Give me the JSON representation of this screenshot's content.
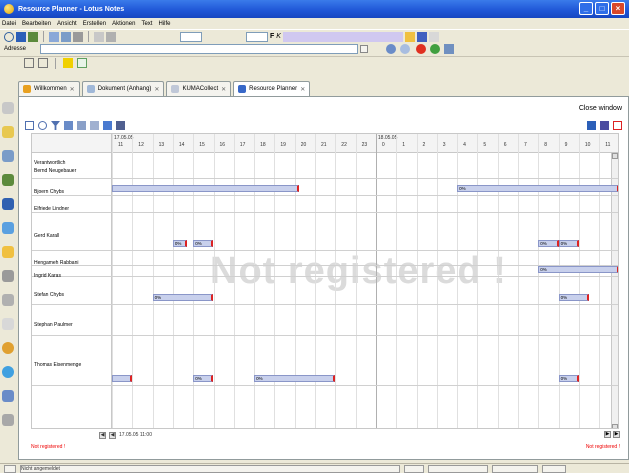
{
  "window": {
    "title": "Resource Planner - Lotus Notes"
  },
  "menu": [
    "Datei",
    "Bearbeiten",
    "Ansicht",
    "Erstellen",
    "Aktionen",
    "Text",
    "Hilfe"
  ],
  "address": {
    "label": "Adresse",
    "value": ""
  },
  "tabs": [
    {
      "label": "Willkommen",
      "active": false
    },
    {
      "label": "Dokument (Anhang)",
      "active": false
    },
    {
      "label": "KUMACollect",
      "active": false
    },
    {
      "label": "Resource Planner",
      "active": true
    }
  ],
  "content": {
    "close_label": "Close window",
    "watermark": "Not registered !",
    "not_registered_left": "Not registered !",
    "not_registered_right": "Not registered !",
    "nav_date": "17.05.05 11:00"
  },
  "schedule": {
    "person_header": "Verantwortlich",
    "day1_label": "17.05.05",
    "day2_label": "18.05.05",
    "hours_day1": [
      "11",
      "12",
      "13",
      "14",
      "15",
      "16",
      "17",
      "18",
      "19",
      "20",
      "21",
      "22",
      "23"
    ],
    "hours_day2": [
      "0",
      "1",
      "2",
      "3",
      "4",
      "5",
      "6",
      "7",
      "8",
      "9",
      "10",
      "11"
    ],
    "people": [
      {
        "name": "Bernd Neugebauer"
      },
      {
        "name": "Bjoern Chybs"
      },
      {
        "name": "Elfriede Lindner"
      },
      {
        "name": "Gerd Karall"
      },
      {
        "name": "Hengameh Rabbani"
      },
      {
        "name": "Ingrid Karas"
      },
      {
        "name": "Stefan Chybs"
      },
      {
        "name": "Stephan Paulmer"
      },
      {
        "name": "Thomas Eisenmenge"
      }
    ],
    "bars": [
      {
        "row": 1,
        "start": 0,
        "end": 9.2,
        "label": ""
      },
      {
        "row": 1,
        "start": 17.0,
        "end": 25,
        "label": "0%"
      },
      {
        "row": 3,
        "start": 4.0,
        "end": 5.0,
        "label": "0%"
      },
      {
        "row": 3,
        "start": 21.0,
        "end": 22.0,
        "label": "0%"
      },
      {
        "row": 3,
        "start": 22.0,
        "end": 23.0,
        "label": "0%"
      },
      {
        "row": 3,
        "start": 3.0,
        "end": 3.7,
        "label": "0%"
      },
      {
        "row": 5,
        "start": 21.0,
        "end": 25,
        "label": "0%"
      },
      {
        "row": 6,
        "start": 2.0,
        "end": 5.0,
        "label": "0%"
      },
      {
        "row": 6,
        "start": 22.0,
        "end": 23.5,
        "label": "0%"
      },
      {
        "row": 8,
        "start": 0,
        "end": 1.0,
        "label": ""
      },
      {
        "row": 8,
        "start": 4.0,
        "end": 5.0,
        "label": "0%"
      },
      {
        "row": 8,
        "start": 7.0,
        "end": 11.0,
        "label": "0%"
      },
      {
        "row": 8,
        "start": 22.0,
        "end": 23.0,
        "label": "0%"
      }
    ]
  },
  "status": {
    "text": "Nicht angemeldet"
  }
}
